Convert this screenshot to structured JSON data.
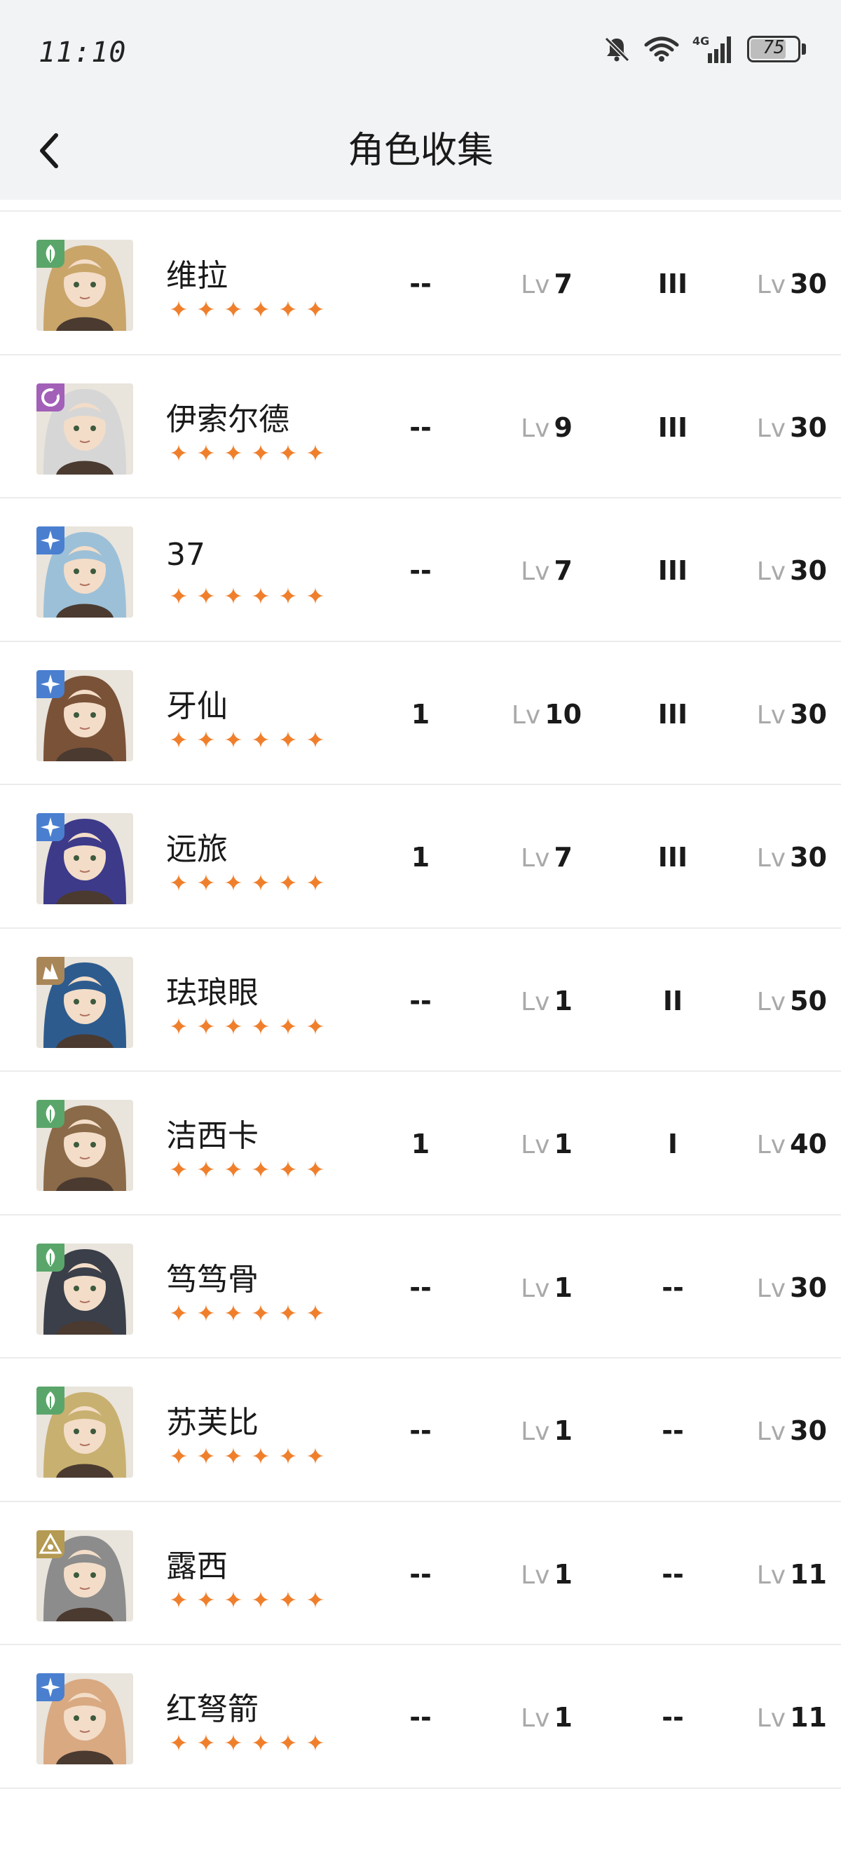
{
  "status_bar": {
    "time": "11:10",
    "battery": "75",
    "battery_level": 0.75,
    "network": "4G"
  },
  "header": {
    "title": "角色收集"
  },
  "colors": {
    "star": "#f07f2c",
    "element_green": "#5aa66a",
    "element_purple": "#a260b8",
    "element_blue": "#4a7fd0",
    "element_brown": "#a98658",
    "element_olive": "#b49a52"
  },
  "lv_prefix": "Lv",
  "characters": [
    {
      "name": "维拉",
      "element": "green-leaf-icon",
      "rarity": 6,
      "col_a": "--",
      "level": "7",
      "col_c": "III",
      "cap": "30",
      "tone": "#c9a56a"
    },
    {
      "name": "伊索尔德",
      "element": "purple-moon-icon",
      "rarity": 6,
      "col_a": "--",
      "level": "9",
      "col_c": "III",
      "cap": "30",
      "tone": "#d6d6d6"
    },
    {
      "name": "37",
      "element": "blue-star-icon",
      "rarity": 6,
      "col_a": "--",
      "level": "7",
      "col_c": "III",
      "cap": "30",
      "tone": "#9cc0d8"
    },
    {
      "name": "牙仙",
      "element": "blue-star-icon",
      "rarity": 6,
      "col_a": "1",
      "level": "10",
      "col_c": "III",
      "cap": "30",
      "tone": "#7a5238"
    },
    {
      "name": "远旅",
      "element": "blue-star-icon",
      "rarity": 6,
      "col_a": "1",
      "level": "7",
      "col_c": "III",
      "cap": "30",
      "tone": "#3d3a8a"
    },
    {
      "name": "珐琅眼",
      "element": "brown-beast-icon",
      "rarity": 6,
      "col_a": "--",
      "level": "1",
      "col_c": "II",
      "cap": "50",
      "tone": "#2d5b8e"
    },
    {
      "name": "洁西卡",
      "element": "green-leaf-icon",
      "rarity": 6,
      "col_a": "1",
      "level": "1",
      "col_c": "I",
      "cap": "40",
      "tone": "#8a6a48"
    },
    {
      "name": "笃笃骨",
      "element": "green-leaf-icon",
      "rarity": 6,
      "col_a": "--",
      "level": "1",
      "col_c": "--",
      "cap": "30",
      "tone": "#3a3f4a"
    },
    {
      "name": "苏芙比",
      "element": "green-leaf-icon",
      "rarity": 6,
      "col_a": "--",
      "level": "1",
      "col_c": "--",
      "cap": "30",
      "tone": "#c8b070"
    },
    {
      "name": "露西",
      "element": "olive-triangle-icon",
      "rarity": 6,
      "col_a": "--",
      "level": "1",
      "col_c": "--",
      "cap": "11",
      "tone": "#8c8c8c"
    },
    {
      "name": "红弩箭",
      "element": "blue-star-icon",
      "rarity": 6,
      "col_a": "--",
      "level": "1",
      "col_c": "--",
      "cap": "11",
      "tone": "#d9a982"
    }
  ]
}
